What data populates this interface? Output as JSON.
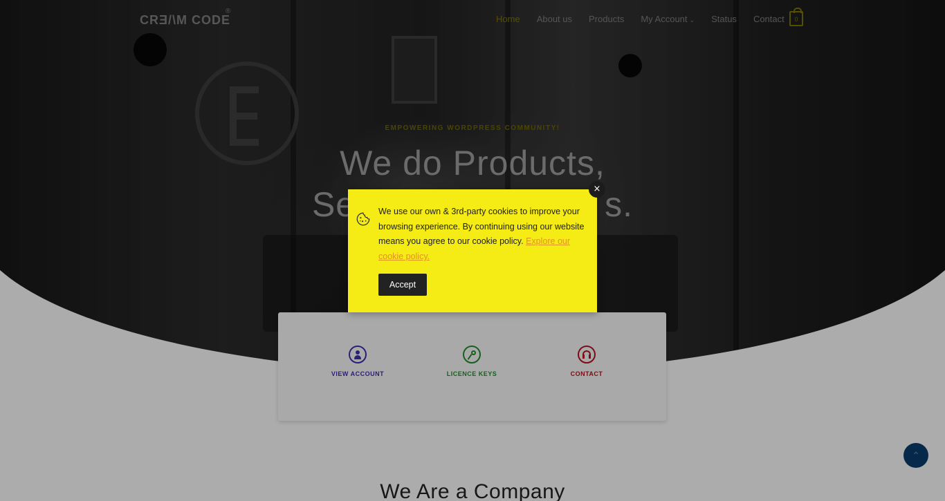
{
  "nav": {
    "logo": "CRƎ/\\M CODE",
    "logo_reg": "®",
    "items": [
      {
        "label": "Home",
        "active": true
      },
      {
        "label": "About us"
      },
      {
        "label": "Products"
      },
      {
        "label": "My Account",
        "dropdown": true
      },
      {
        "label": "Status"
      },
      {
        "label": "Contact"
      }
    ],
    "cart_count": "0"
  },
  "hero": {
    "eyebrow": "EMPOWERING WORDPRESS COMMUNITY!",
    "headline_line1": "We do Products,",
    "headline_line2_left": "Se",
    "headline_line2_right": "s."
  },
  "quick_links": [
    {
      "label": "VIEW ACCOUNT",
      "icon": "user-icon",
      "color": "#3b2fa8"
    },
    {
      "label": "LICENCE KEYS",
      "icon": "key-icon",
      "color": "#1f8a2a"
    },
    {
      "label": "CONTACT",
      "icon": "headphones-icon",
      "color": "#b0141a"
    }
  ],
  "section_title": "We Are a Company",
  "cookie": {
    "text": "We use our own & 3rd-party cookies to improve your browsing experience. By continuing using our website means you agree to our cookie policy.",
    "link": "Explore our cookie policy.",
    "accept": "Accept",
    "close": "×",
    "background": "#f5ec16"
  },
  "scroll_top_icon": "chevron-up-icon"
}
